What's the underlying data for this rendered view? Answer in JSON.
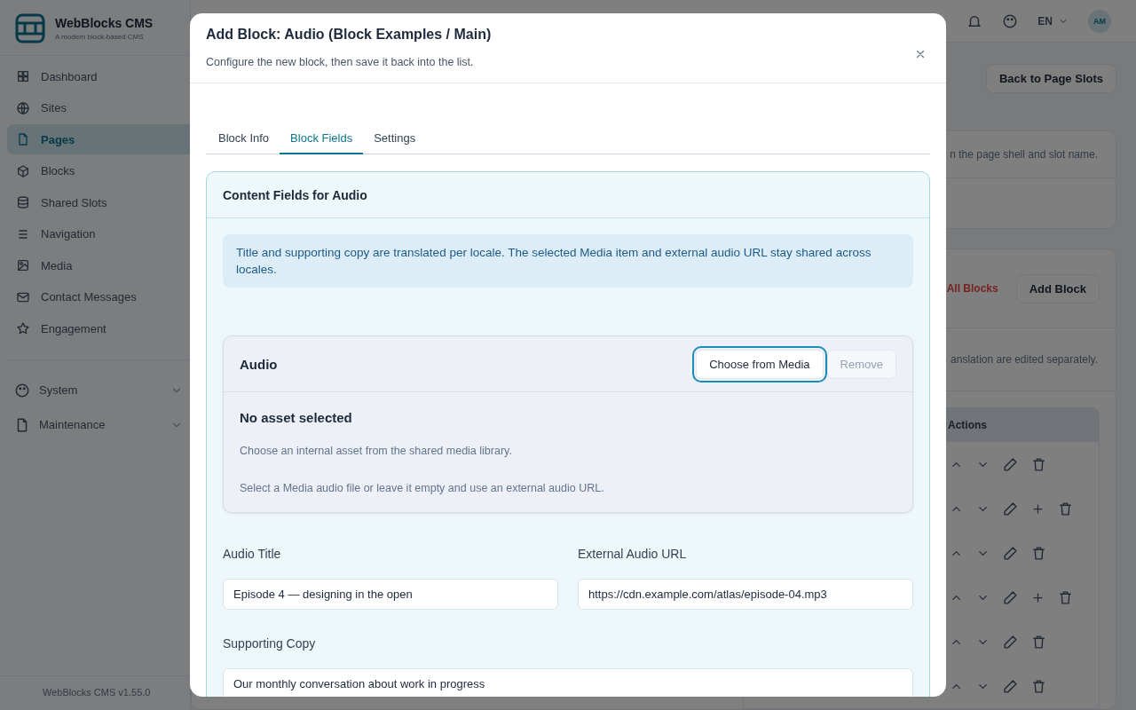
{
  "app": {
    "name": "WebBlocks CMS",
    "tagline": "A modern block-based CMS",
    "version": "WebBlocks CMS v1.55.0",
    "nav": [
      {
        "label": "Dashboard",
        "selected": false
      },
      {
        "label": "Sites",
        "selected": false
      },
      {
        "label": "Pages",
        "selected": true
      },
      {
        "label": "Blocks",
        "selected": false
      },
      {
        "label": "Shared Slots",
        "selected": false
      },
      {
        "label": "Navigation",
        "selected": false
      },
      {
        "label": "Media",
        "selected": false
      },
      {
        "label": "Contact Messages",
        "selected": false
      },
      {
        "label": "Engagement",
        "selected": false
      }
    ],
    "groups": [
      {
        "label": "System",
        "expanded": false
      },
      {
        "label": "Maintenance",
        "expanded": false
      }
    ]
  },
  "topbar": {
    "locale": "EN",
    "avatar": "AM"
  },
  "page": {
    "back_button": "Back to Page Slots",
    "intro_text": "n the page shell and slot name.",
    "delete_all": "All Blocks",
    "add_block": "Add Block",
    "note": "anslation are edited separately.",
    "table": {
      "actions_header": "Actions",
      "rows": [
        {
          "addable": false
        },
        {
          "addable": true
        },
        {
          "addable": false
        },
        {
          "addable": true
        },
        {
          "addable": false
        },
        {
          "addable": false
        }
      ]
    }
  },
  "modal": {
    "title": "Add Block: Audio (Block Examples / Main)",
    "subtitle": "Configure the new block, then save it back into the list.",
    "tabs": [
      {
        "label": "Block Info",
        "selected": false
      },
      {
        "label": "Block Fields",
        "selected": true
      },
      {
        "label": "Settings",
        "selected": false
      }
    ],
    "section_title": "Content Fields for Audio",
    "info": "Title and supporting copy are translated per locale. The selected Media item and external audio URL stay shared across locales.",
    "asset": {
      "label": "Audio",
      "choose_button": {
        "label": "Choose from Media",
        "focused": true
      },
      "remove_button": {
        "label": "Remove",
        "disabled": true
      },
      "empty_title": "No asset selected",
      "help": "Choose an internal asset from the shared media library.",
      "hint": "Select a Media audio file or leave it empty and use an external audio URL."
    },
    "fields": [
      {
        "label": "Audio Title",
        "value": "Episode 4 — designing in the open"
      },
      {
        "label": "External Audio URL",
        "value": "https://cdn.example.com/atlas/episode-04.mp3"
      }
    ],
    "supporting_copy": {
      "label": "Supporting Copy",
      "value": "Our monthly conversation about work in progress"
    }
  }
}
